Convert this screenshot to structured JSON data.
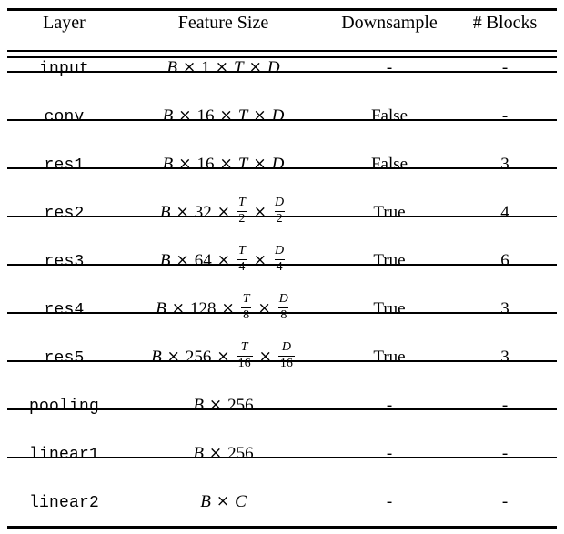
{
  "table": {
    "headers": [
      "Layer",
      "Feature Size",
      "Downsample",
      "# Blocks"
    ],
    "rows": [
      {
        "layer": "input",
        "feature_size_text": "B × 1 × T × D",
        "feature_parts": [
          {
            "t": "mi",
            "v": "B"
          },
          {
            "t": "op",
            "v": "×"
          },
          {
            "t": "mn",
            "v": "1"
          },
          {
            "t": "op",
            "v": "×"
          },
          {
            "t": "mi",
            "v": "T"
          },
          {
            "t": "op",
            "v": "×"
          },
          {
            "t": "mi",
            "v": "D"
          }
        ],
        "downsample": "-",
        "blocks": "-"
      },
      {
        "layer": "conv",
        "feature_size_text": "B × 16 × T × D",
        "feature_parts": [
          {
            "t": "mi",
            "v": "B"
          },
          {
            "t": "op",
            "v": "×"
          },
          {
            "t": "mn",
            "v": "16"
          },
          {
            "t": "op",
            "v": "×"
          },
          {
            "t": "mi",
            "v": "T"
          },
          {
            "t": "op",
            "v": "×"
          },
          {
            "t": "mi",
            "v": "D"
          }
        ],
        "downsample": "False",
        "blocks": "-"
      },
      {
        "layer": "res1",
        "feature_size_text": "B × 16 × T × D",
        "feature_parts": [
          {
            "t": "mi",
            "v": "B"
          },
          {
            "t": "op",
            "v": "×"
          },
          {
            "t": "mn",
            "v": "16"
          },
          {
            "t": "op",
            "v": "×"
          },
          {
            "t": "mi",
            "v": "T"
          },
          {
            "t": "op",
            "v": "×"
          },
          {
            "t": "mi",
            "v": "D"
          }
        ],
        "downsample": "False",
        "blocks": "3"
      },
      {
        "layer": "res2",
        "feature_size_text": "B × 32 × T/2 × D/2",
        "feature_parts": [
          {
            "t": "mi",
            "v": "B"
          },
          {
            "t": "op",
            "v": "×"
          },
          {
            "t": "mn",
            "v": "32"
          },
          {
            "t": "op",
            "v": "×"
          },
          {
            "t": "frac",
            "num": "T",
            "den": "2"
          },
          {
            "t": "op",
            "v": "×"
          },
          {
            "t": "frac",
            "num": "D",
            "den": "2"
          }
        ],
        "downsample": "True",
        "blocks": "4"
      },
      {
        "layer": "res3",
        "feature_size_text": "B × 64 × T/4 × D/4",
        "feature_parts": [
          {
            "t": "mi",
            "v": "B"
          },
          {
            "t": "op",
            "v": "×"
          },
          {
            "t": "mn",
            "v": "64"
          },
          {
            "t": "op",
            "v": "×"
          },
          {
            "t": "frac",
            "num": "T",
            "den": "4"
          },
          {
            "t": "op",
            "v": "×"
          },
          {
            "t": "frac",
            "num": "D",
            "den": "4"
          }
        ],
        "downsample": "True",
        "blocks": "6"
      },
      {
        "layer": "res4",
        "feature_size_text": "B × 128 × T/8 × D/8",
        "feature_parts": [
          {
            "t": "mi",
            "v": "B"
          },
          {
            "t": "op",
            "v": "×"
          },
          {
            "t": "mn",
            "v": "128"
          },
          {
            "t": "op",
            "v": "×"
          },
          {
            "t": "frac",
            "num": "T",
            "den": "8"
          },
          {
            "t": "op",
            "v": "×"
          },
          {
            "t": "frac",
            "num": "D",
            "den": "8"
          }
        ],
        "downsample": "True",
        "blocks": "3"
      },
      {
        "layer": "res5",
        "feature_size_text": "B × 256 × T/16 × D/16",
        "feature_parts": [
          {
            "t": "mi",
            "v": "B"
          },
          {
            "t": "op",
            "v": "×"
          },
          {
            "t": "mn",
            "v": "256"
          },
          {
            "t": "op",
            "v": "×"
          },
          {
            "t": "frac",
            "num": "T",
            "den": "16"
          },
          {
            "t": "op",
            "v": "×"
          },
          {
            "t": "frac",
            "num": "D",
            "den": "16"
          }
        ],
        "downsample": "True",
        "blocks": "3"
      },
      {
        "layer": "pooling",
        "feature_size_text": "B × 256",
        "feature_parts": [
          {
            "t": "mi",
            "v": "B"
          },
          {
            "t": "op",
            "v": "×"
          },
          {
            "t": "mn",
            "v": "256"
          }
        ],
        "downsample": "-",
        "blocks": "-"
      },
      {
        "layer": "linear1",
        "feature_size_text": "B × 256",
        "feature_parts": [
          {
            "t": "mi",
            "v": "B"
          },
          {
            "t": "op",
            "v": "×"
          },
          {
            "t": "mn",
            "v": "256"
          }
        ],
        "downsample": "-",
        "blocks": "-"
      },
      {
        "layer": "linear2",
        "feature_size_text": "B × C",
        "feature_parts": [
          {
            "t": "mi",
            "v": "B"
          },
          {
            "t": "op",
            "v": "×"
          },
          {
            "t": "mi",
            "v": "C"
          }
        ],
        "downsample": "-",
        "blocks": "-"
      }
    ]
  },
  "style": {
    "text_color": "#000000",
    "background": "#ffffff",
    "rule_color": "#000000"
  }
}
